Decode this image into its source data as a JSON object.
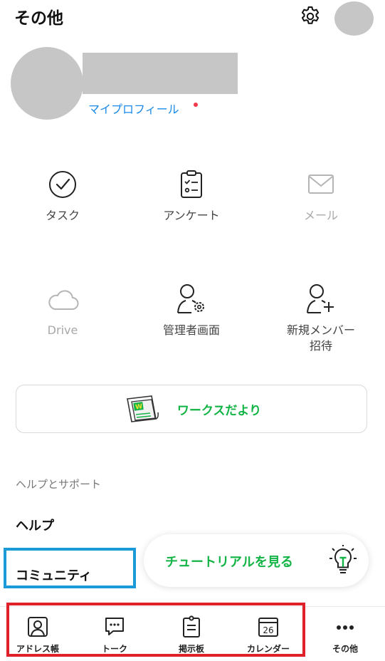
{
  "header": {
    "title": "その他",
    "settings_icon": "gear-icon"
  },
  "profile": {
    "link_label": "マイプロフィール",
    "notification_color": "#f0394a"
  },
  "grid": [
    {
      "label": "タスク",
      "icon": "task-check-icon",
      "enabled": true
    },
    {
      "label": "アンケート",
      "icon": "survey-clipboard-icon",
      "enabled": true
    },
    {
      "label": "メール",
      "icon": "mail-icon",
      "enabled": false
    },
    {
      "label": "Drive",
      "icon": "cloud-icon",
      "enabled": false
    },
    {
      "label": "管理者画面",
      "icon": "admin-user-gear-icon",
      "enabled": true
    },
    {
      "label": "新規メンバー\n招待",
      "icon": "add-user-icon",
      "enabled": true
    }
  ],
  "banner": {
    "label": "ワークスだより",
    "icon": "newsletter-icon"
  },
  "help": {
    "section_header": "ヘルプとサポート",
    "help_label": "ヘルプ",
    "community_label": "コミュニティ"
  },
  "tutorial": {
    "label": "チュートリアルを見る",
    "icon": "lightbulb-icon"
  },
  "bottom_nav": [
    {
      "label": "アドレス帳",
      "icon": "address-book-icon"
    },
    {
      "label": "トーク",
      "icon": "chat-bubble-icon"
    },
    {
      "label": "掲示板",
      "icon": "bulletin-board-icon"
    },
    {
      "label": "カレンダー",
      "icon": "calendar-icon",
      "date": "26"
    },
    {
      "label": "その他",
      "icon": "more-dots-icon"
    }
  ],
  "colors": {
    "accent_green": "#13b446",
    "link_blue": "#1a8ae6",
    "highlight_blue": "#1a9bd7",
    "highlight_red": "#e0202a"
  }
}
